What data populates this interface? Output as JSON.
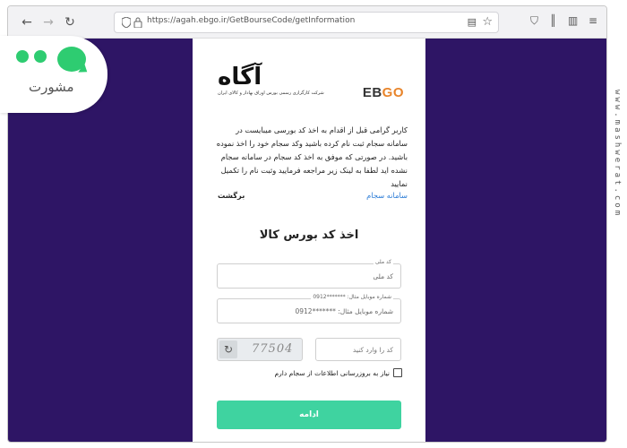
{
  "browser": {
    "url": "https://agah.ebgo.ir/GetBourseCode/getInformation"
  },
  "brand": {
    "agah_word": "آگاه",
    "agah_tagline": "شرکت کارگزاری رسمی بورس اوراق بهادار و کالای ایران",
    "ebgo_eb": "EB",
    "ebgo_go": "GO"
  },
  "page": {
    "intro_text": "کاربر گرامی قبل از اقدام به اخذ کد بورسی میبایست در سامانه سجام ثبت نام کرده باشید وکد سجام خود را اخذ نموده باشید. در صورتی که موفق به اخذ کد سجام در سامانه سجام نشده اید لطفا به لینک زیر مراجعه فرمایید وثبت نام را تکمیل نمایید",
    "link_samaneh": "سامانه سجام",
    "link_back": "برگشت",
    "form_title": "اخذ کد بورس کالا",
    "national_code": {
      "label": "کد ملی",
      "placeholder": "کد ملی"
    },
    "mobile": {
      "label": "شماره موبایل مثال: *******0912",
      "placeholder": "شماره موبایل مثال: *******0912"
    },
    "captcha": {
      "placeholder": "کد را وارد کنید",
      "code": "77504"
    },
    "checkbox_label": "نیاز به بروزرسانی اطلاعات از سجام دارم",
    "submit_label": "ادامه"
  },
  "overlay": {
    "brand_word": "مشورت",
    "side_url": "www.mashwerat.com"
  },
  "colors": {
    "page_bg": "#2e1565",
    "accent_button": "#3fd3a0",
    "link": "#2a7bd6",
    "brand_green": "#2ecc71"
  },
  "icons": [
    "back-arrow-icon",
    "forward-arrow-icon",
    "reload-icon",
    "shield-icon",
    "lock-icon",
    "reader-view-icon",
    "star-icon",
    "extension-icon",
    "library-icon",
    "sidebar-icon",
    "menu-icon",
    "captcha-refresh-icon"
  ]
}
